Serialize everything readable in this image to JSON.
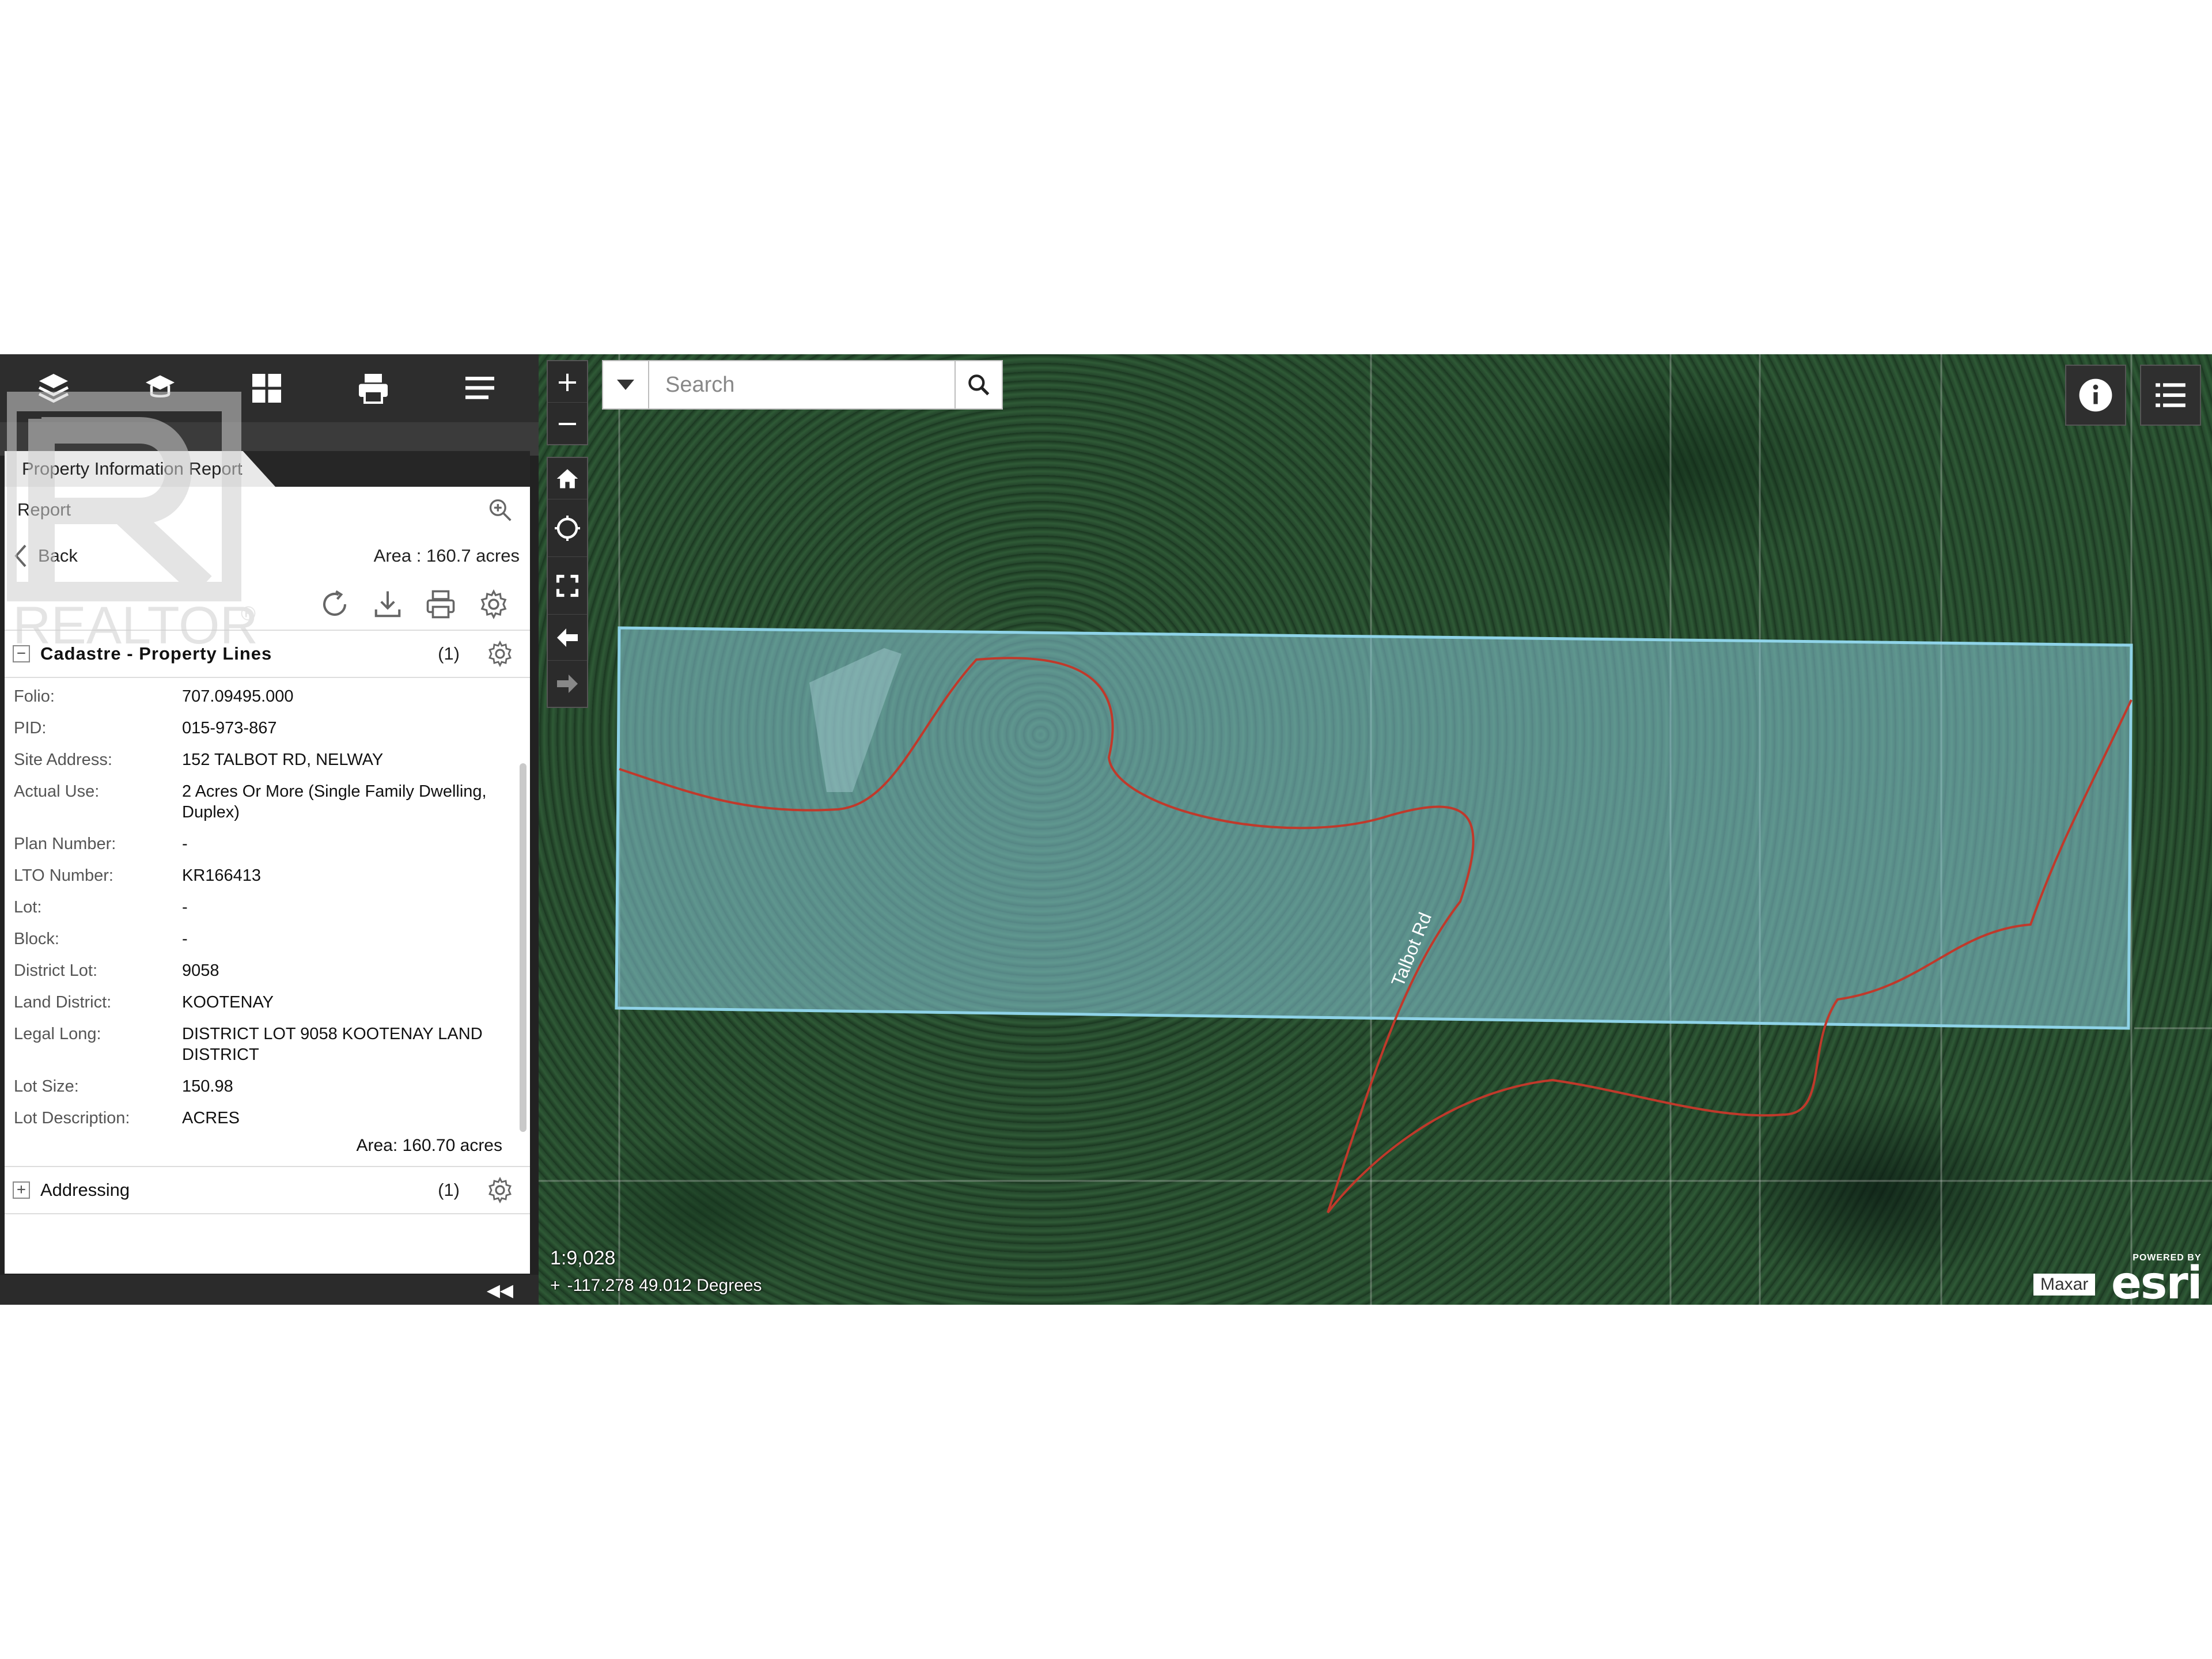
{
  "panel": {
    "tab_label": "Property Information Report",
    "report_label": "Report",
    "back_label": "Back",
    "area_header": "Area : 160.7 acres",
    "watermark_text": "REALTOR",
    "toolbar_icons": [
      "layers-icon",
      "basemap-icon",
      "widgets-grid-icon",
      "print-icon",
      "menu-icon"
    ],
    "action_icons": [
      "refresh-icon",
      "download-icon",
      "print-icon",
      "settings-icon"
    ],
    "cadastre": {
      "title": "Cadastre - Property Lines",
      "count": "(1)",
      "properties": [
        {
          "key": "Folio:",
          "value": "707.09495.000"
        },
        {
          "key": "PID:",
          "value": "015-973-867"
        },
        {
          "key": "Site Address:",
          "value": "152 TALBOT RD, NELWAY"
        },
        {
          "key": "Actual Use:",
          "value": "2 Acres Or More (Single Family Dwelling, Duplex)"
        },
        {
          "key": "Plan Number:",
          "value": "-"
        },
        {
          "key": "LTO Number:",
          "value": "KR166413"
        },
        {
          "key": "Lot:",
          "value": "-"
        },
        {
          "key": "Block:",
          "value": "-"
        },
        {
          "key": "District Lot:",
          "value": "9058"
        },
        {
          "key": "Land District:",
          "value": "KOOTENAY"
        },
        {
          "key": "Legal Long:",
          "value": "DISTRICT LOT 9058 KOOTENAY LAND DISTRICT"
        },
        {
          "key": "Lot Size:",
          "value": "150.98"
        },
        {
          "key": "Lot Description:",
          "value": "ACRES"
        }
      ],
      "area_footer": "Area: 160.70 acres"
    },
    "addressing": {
      "title": "Addressing",
      "count": "(1)"
    },
    "collapse_label": "◀◀"
  },
  "map": {
    "search": {
      "placeholder": "Search"
    },
    "road_label": "Talbot Rd",
    "scale": "1:9,028",
    "coordinates": "-117.278 49.012 Degrees",
    "attribution": "Maxar",
    "powered_by": "POWERED BY",
    "brand": "esri",
    "parcel_color": "#8fd3e8",
    "road_color": "#c0392b"
  }
}
